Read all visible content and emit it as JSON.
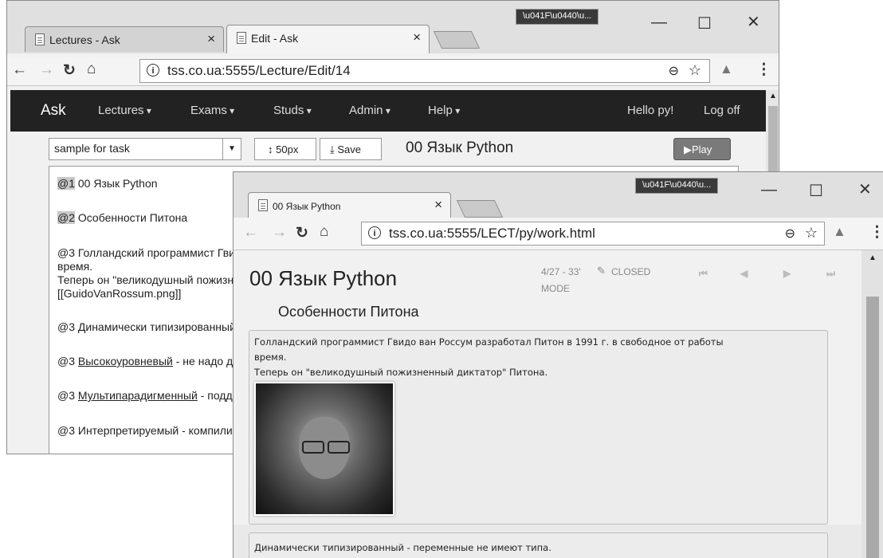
{
  "win1": {
    "tabs": [
      {
        "label": "Lectures - Ask",
        "close": "×"
      },
      {
        "label": "Edit - Ask",
        "close": "×"
      }
    ],
    "profile": "\\u041F\\u0440\\u...",
    "controls": {
      "minimize": "—",
      "maximize": "☐",
      "close": "✕"
    },
    "url": "tss.co.ua:5555/Lecture/Edit/14",
    "navbar": {
      "brand": "Ask",
      "items": [
        "Lectures",
        "Exams",
        "Studs",
        "Admin",
        "Help"
      ],
      "user": "Hello py!",
      "logoff": "Log off"
    },
    "task_select": "sample for task",
    "size_button": "50px",
    "save_button": "Save",
    "lecture_title": "00 Язык Python",
    "play_button": "Play",
    "editor": {
      "l1_tag": "@1",
      "l1_text": " 00 Язык Python",
      "l2_tag": "@2",
      "l2_text": " Особенности Питона",
      "l3a": "@3 Голландский программист Гвидо ван Россум разработал Питон в 1991 г. в свободное от работы",
      "l3b": "время.",
      "l3c": "Теперь он \"великодушный пожизненный диктатор\" Питона.",
      "l3d": "[[GuidoVanRossum.png]]",
      "l4": "@3 Динамически типизированный - переменные не имеют типа.",
      "l5_pre": "@3 ",
      "l5_link": "Высокоуровневый",
      "l5_post": " - не надо думать о низкоуровневых деталях.",
      "l6_pre": "@3 ",
      "l6_link": "Мультипарадигменный",
      "l6_post": " - поддерживает разные парадигмы.",
      "l7": "@3 Интерпретируемый - компилируется в байт-код."
    }
  },
  "win2": {
    "tab": {
      "label": "00 Язык Python",
      "close": "×"
    },
    "profile": "\\u041F\\u0440\\u...",
    "controls": {
      "minimize": "—",
      "maximize": "☐",
      "close": "✕"
    },
    "url": "tss.co.ua:5555/LECT/py/work.html",
    "title": "00 Язык Python",
    "meta_line1": "4/27 - 33'",
    "meta_closed": "CLOSED",
    "meta_mode": "MODE",
    "subtitle": "Особенности Питона",
    "card1_line1": "Голландский программист Гвидо ван Россум разработал Питон в 1991 г. в свободное от работы",
    "card1_line2": "время.",
    "card1_line3": "Теперь он \"великодушный пожизненный диктатор\" Питона.",
    "card2": "Динамически типизированный - переменные не имеют типа."
  }
}
